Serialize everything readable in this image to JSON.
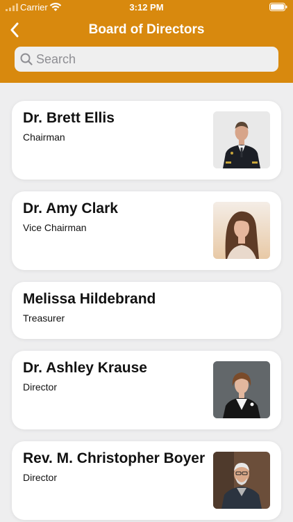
{
  "status_bar": {
    "carrier": "Carrier",
    "time": "3:12 PM"
  },
  "nav": {
    "title": "Board of Directors",
    "back_icon": "chevron-left-icon"
  },
  "search": {
    "placeholder": "Search",
    "value": ""
  },
  "directors": [
    {
      "name": "Dr. Brett Ellis",
      "role": "Chairman",
      "has_photo": true
    },
    {
      "name": "Dr. Amy Clark",
      "role": "Vice Chairman",
      "has_photo": true
    },
    {
      "name": "Melissa Hildebrand",
      "role": "Treasurer",
      "has_photo": false
    },
    {
      "name": "Dr. Ashley Krause",
      "role": "Director",
      "has_photo": true
    },
    {
      "name": "Rev. M. Christopher Boyer",
      "role": "Director",
      "has_photo": true
    }
  ],
  "colors": {
    "accent": "#d8890e",
    "background": "#eeeeef",
    "card": "#ffffff"
  }
}
